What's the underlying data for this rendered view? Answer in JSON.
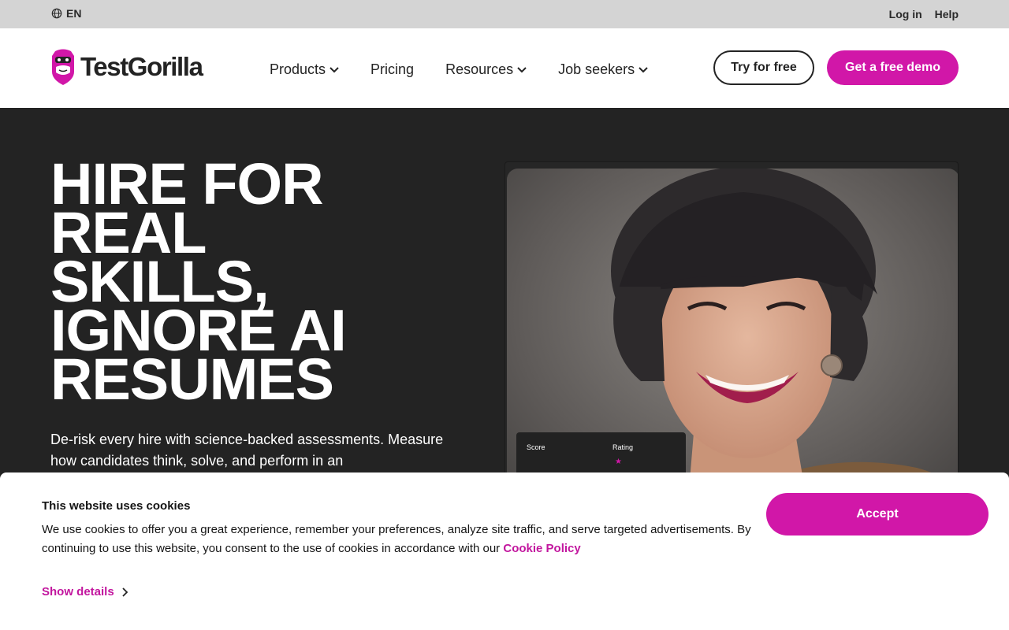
{
  "utility_bar": {
    "language": "EN",
    "login": "Log in",
    "help": "Help"
  },
  "header": {
    "logo_text": "TestGorilla",
    "nav": [
      {
        "label": "Products",
        "has_dropdown": true
      },
      {
        "label": "Pricing",
        "has_dropdown": false
      },
      {
        "label": "Resources",
        "has_dropdown": true
      },
      {
        "label": "Job seekers",
        "has_dropdown": true
      }
    ],
    "try_free": "Try for free",
    "demo": "Get a free demo"
  },
  "hero": {
    "title_lines": [
      "HIRE FOR",
      "REAL",
      "SKILLS,",
      "IGNORE AI",
      "RESUMES"
    ],
    "subtitle": "De-risk every hire with science-backed assessments. Measure how candidates think, solve, and perform in an",
    "score_card": {
      "score_label": "Score",
      "rating_label": "Rating",
      "star": "★"
    }
  },
  "cookie": {
    "title": "This website uses cookies",
    "body": "We use cookies to offer you a great experience, remember your preferences, analyze site traffic, and serve targeted advertisements. By continuing to use this website, you consent to the use of cookies in accordance with our",
    "policy_link": "Cookie Policy",
    "accept": "Accept",
    "show_details": "Show details"
  },
  "colors": {
    "brand": "#d117a8",
    "hero_bg": "#232323",
    "utility_bg": "#d4d4d4"
  },
  "icons": [
    "globe-icon",
    "gorilla-logo-icon",
    "chevron-down-icon",
    "chevron-right-icon",
    "star-icon"
  ]
}
